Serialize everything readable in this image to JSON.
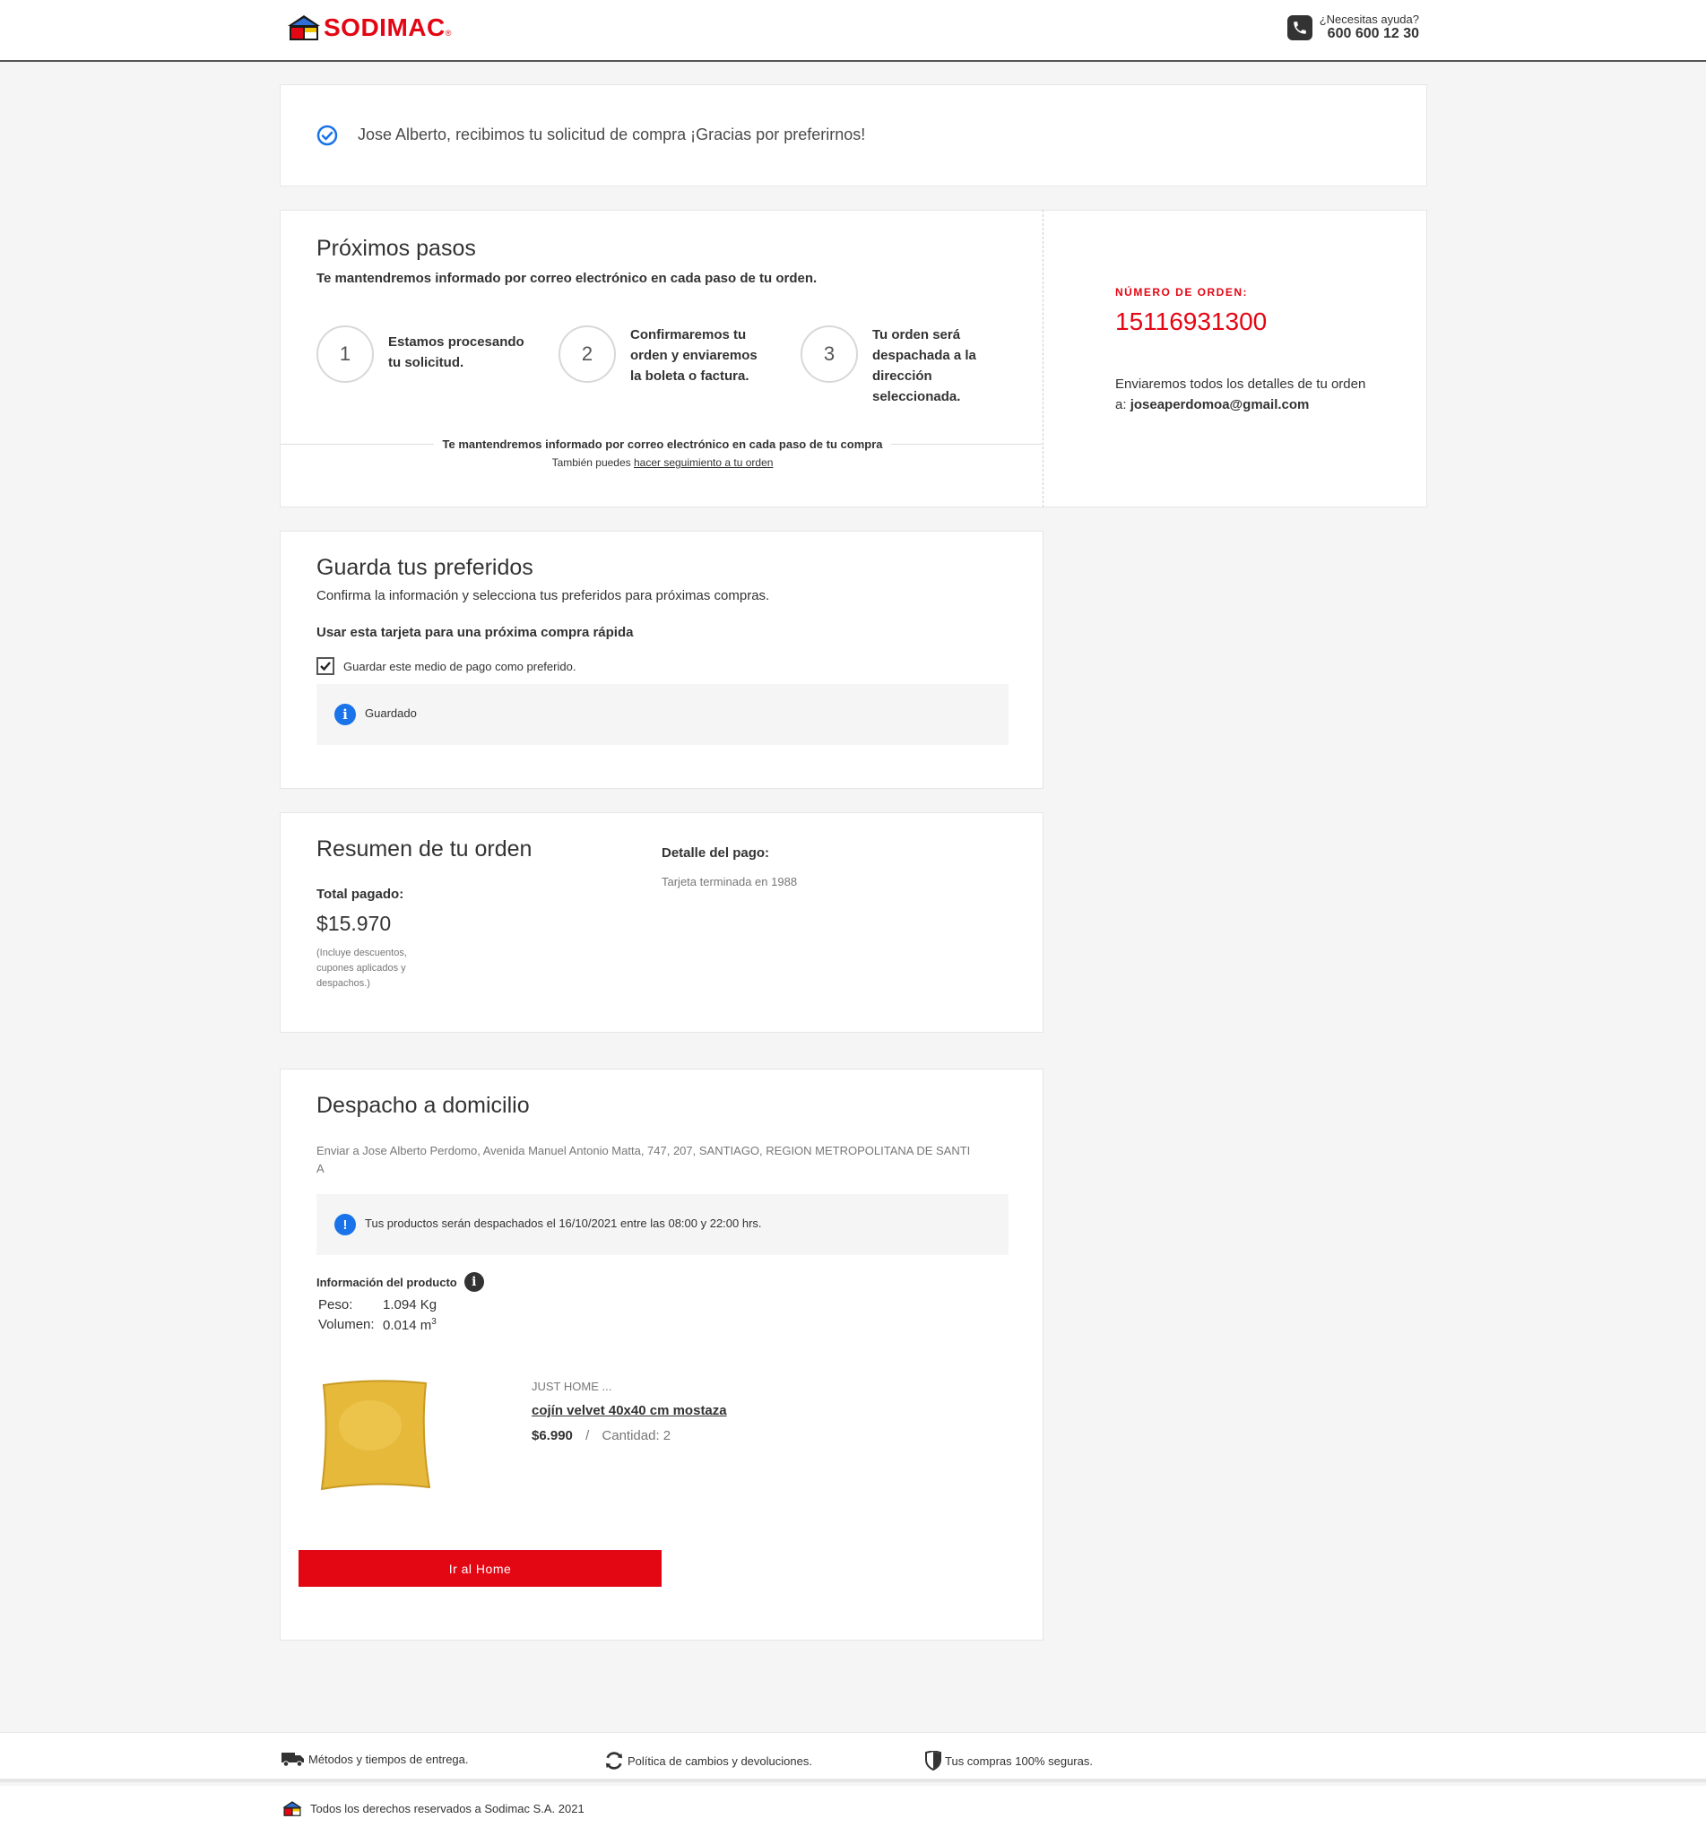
{
  "header": {
    "brand": "SODIMAC",
    "help_question": "¿Necesitas ayuda?",
    "help_phone": "600 600 12 30"
  },
  "confirm": {
    "message": "Jose Alberto, recibimos tu solicitud de compra ¡Gracias por preferirnos!"
  },
  "steps": {
    "title": "Próximos pasos",
    "subtitle": "Te mantendremos informado por correo electrónico en cada paso de tu orden.",
    "items": [
      {
        "number": "1",
        "text": "Estamos procesando tu solicitud."
      },
      {
        "number": "2",
        "text": "Confirmaremos tu orden y enviaremos la boleta o factura."
      },
      {
        "number": "3",
        "text": "Tu orden será despachada a la dirección seleccionada."
      }
    ],
    "footer_note": "Te mantendremos informado por correo electrónico en cada paso de tu compra",
    "tracking_prefix": "También puedes",
    "tracking_link": "hacer seguimiento a tu orden"
  },
  "order": {
    "label": "NÚMERO DE ORDEN:",
    "number": "15116931300",
    "mail_prefix": "Enviaremos todos los detalles de tu orden a:",
    "email": "joseaperdomoa@gmail.com"
  },
  "preferences": {
    "title": "Guarda tus preferidos",
    "subtitle": "Confirma la información y selecciona tus preferidos para próximas compras.",
    "card_heading": "Usar esta tarjeta para una próxima compra rápida",
    "checkbox_label": "Guardar este medio de pago como preferido.",
    "checkbox_checked": true,
    "status": "Guardado"
  },
  "summary": {
    "title": "Resumen de tu orden",
    "total_label": "Total pagado:",
    "total_value": "$15.970",
    "total_note": "(Incluye descuentos, cupones aplicados y despachos.)",
    "payment_label": "Detalle del pago:",
    "payment_detail": "Tarjeta terminada en 1988"
  },
  "delivery": {
    "title": "Despacho a domicilio",
    "address_line1": "Enviar a Jose Alberto Perdomo, Avenida Manuel Antonio Matta, 747, 207, SANTIAGO, REGION METROPOLITANA DE SANTI",
    "address_line2": "A",
    "notice": "Tus productos serán despachados el 16/10/2021 entre las 08:00 y 22:00 hrs.",
    "product_info_label": "Información del producto",
    "weight_label": "Peso:",
    "weight_value": "1.094 Kg",
    "volume_label": "Volumen:",
    "volume_value": "0.014 m",
    "volume_exp": "3",
    "product": {
      "brand": "JUST HOME ...",
      "name": "cojín velvet 40x40 cm mostaza",
      "price": "$6.990",
      "separator": "/",
      "quantity": "Cantidad: 2",
      "image_color": "#e6b93a"
    },
    "home_button": "Ir al Home"
  },
  "footer": {
    "links": [
      {
        "label": "Métodos y tiempos de entrega.",
        "icon": "truck-icon"
      },
      {
        "label": "Política de cambios y devoluciones.",
        "icon": "refresh-icon"
      },
      {
        "label": "Tus compras 100% seguras.",
        "icon": "shield-icon"
      }
    ],
    "copyright": "Todos los derechos reservados a Sodimac S.A.  2021"
  },
  "colors": {
    "brand_red": "#e30613",
    "info_blue": "#1a73e8",
    "background": "#f5f5f5"
  }
}
